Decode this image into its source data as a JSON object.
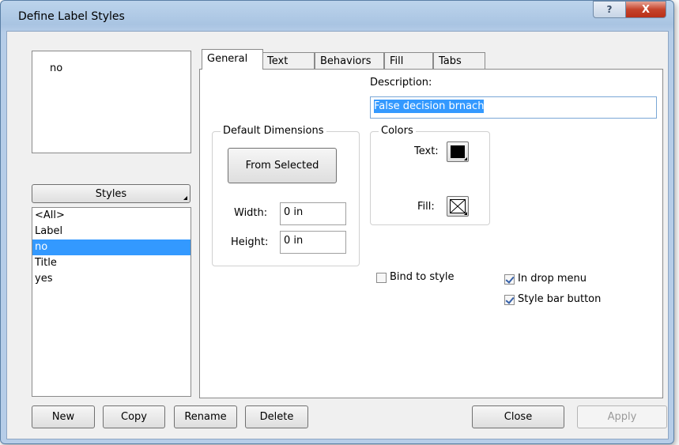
{
  "window": {
    "title": "Define Label Styles",
    "help_symbol": "?",
    "close_symbol": "X"
  },
  "preview": {
    "text": "no"
  },
  "styles_dropdown": {
    "label": "Styles"
  },
  "styles_list": {
    "items": [
      "<All>",
      "Label",
      "no",
      "Title",
      "yes"
    ],
    "selected": "no"
  },
  "tabs": [
    "General",
    "Text",
    "Behaviors",
    "Fill",
    "Tabs"
  ],
  "active_tab": "General",
  "general": {
    "description_label": "Description:",
    "description_value": "False decision brnach",
    "default_dimensions": {
      "title": "Default Dimensions",
      "from_selected_label": "From Selected",
      "width_label": "Width:",
      "width_value": "0 in",
      "height_label": "Height:",
      "height_value": "0 in"
    },
    "colors": {
      "title": "Colors",
      "text_label": "Text:",
      "text_color": "#000000",
      "fill_label": "Fill:",
      "fill_value": "none"
    },
    "bind_to_style": {
      "label": "Bind to style",
      "checked": false
    },
    "in_drop_menu": {
      "label": "In drop menu",
      "checked": true
    },
    "style_bar_button": {
      "label": "Style bar button",
      "checked": true
    }
  },
  "footer": {
    "new_label": "New",
    "copy_label": "Copy",
    "rename_label": "Rename",
    "delete_label": "Delete",
    "close_label": "Close",
    "apply_label": "Apply"
  },
  "colors": {
    "selection": "#3399ff",
    "close_button": "#c5442c",
    "titlebar": "#a9c4e2"
  }
}
